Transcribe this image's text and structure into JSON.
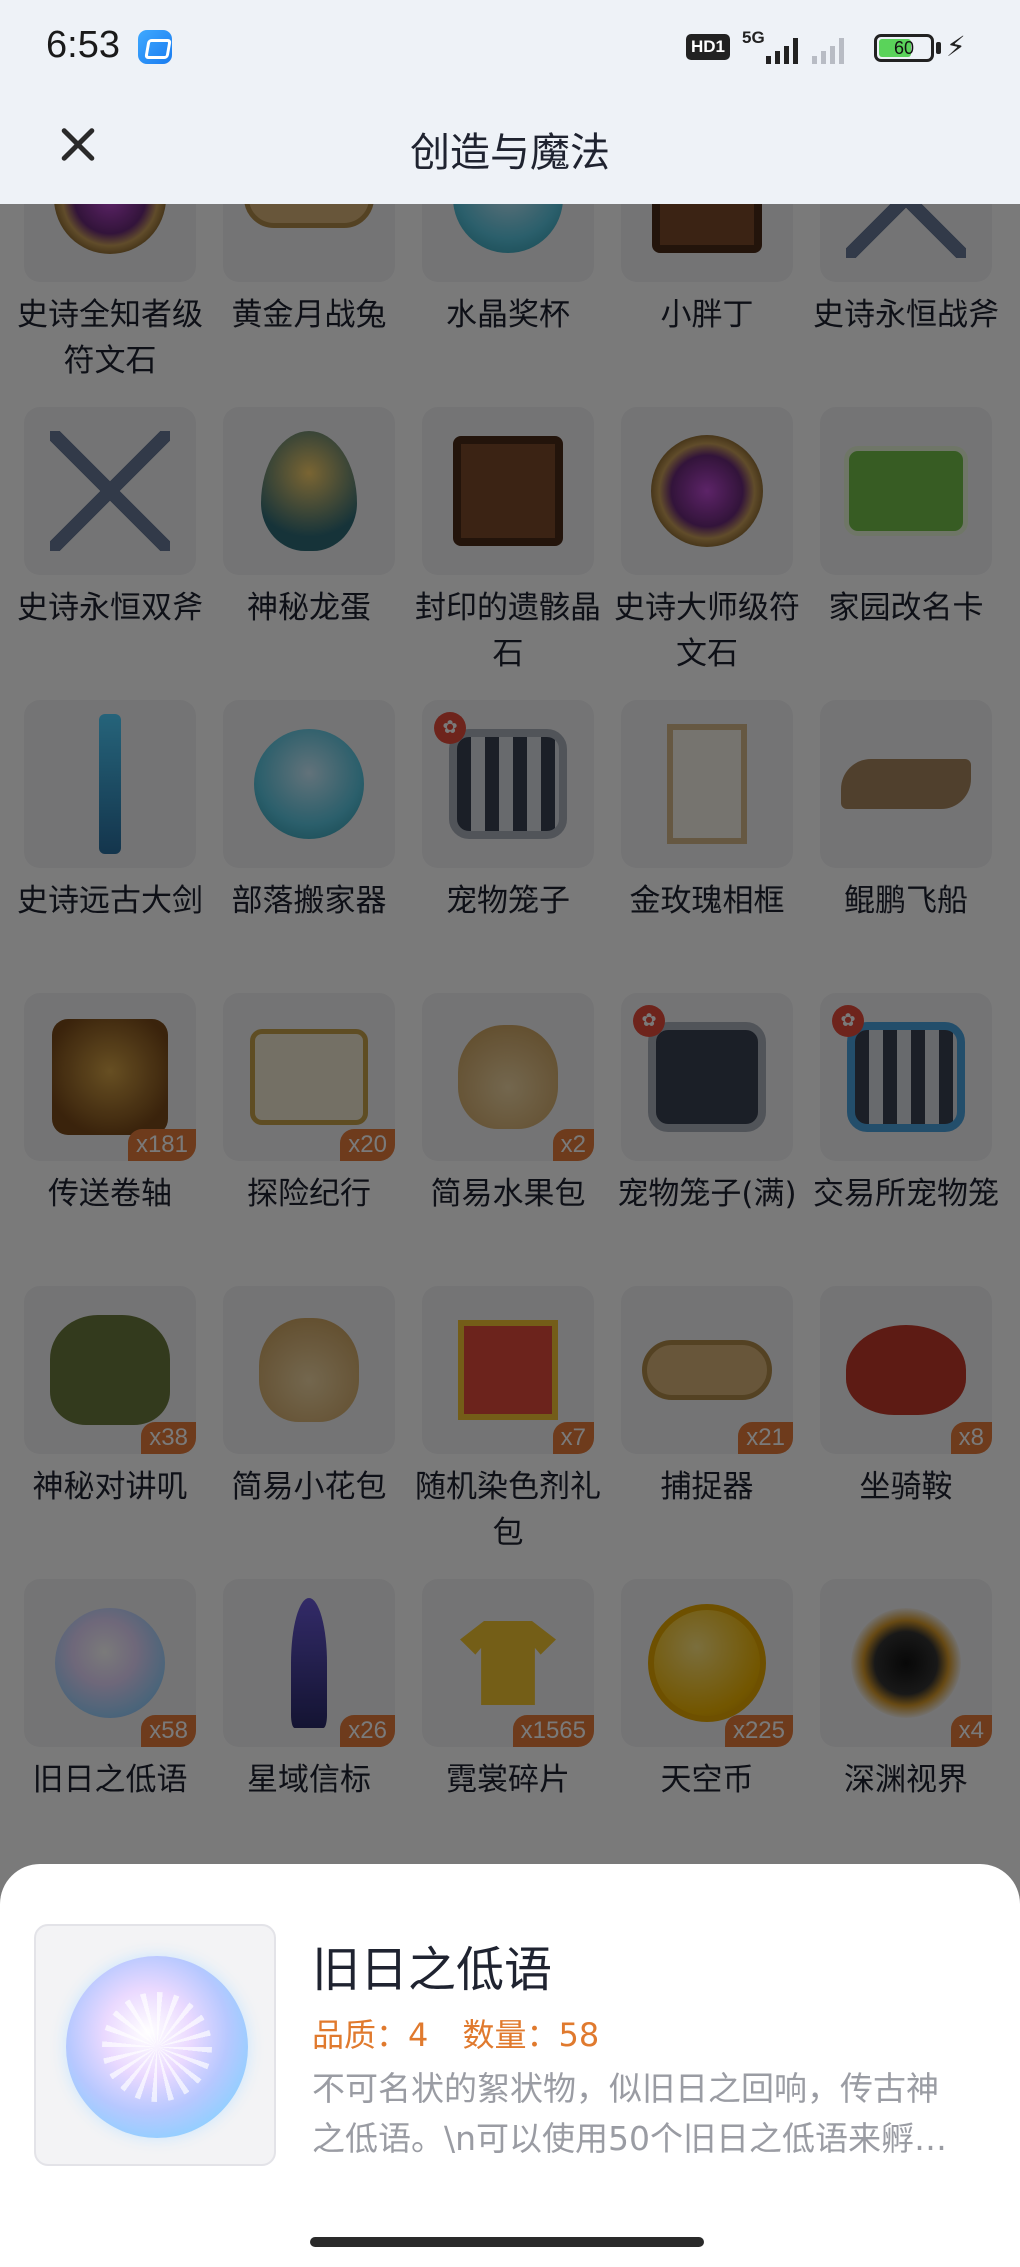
{
  "status_bar": {
    "time": "6:53",
    "hd_label": "HD1",
    "network_label": "5G",
    "battery": "60"
  },
  "header": {
    "title": "创造与魔法"
  },
  "items": [
    {
      "name": "史诗全知者级符文石",
      "art": "rune",
      "count": ""
    },
    {
      "name": "黄金月战兔",
      "art": "crown",
      "count": ""
    },
    {
      "name": "水晶奖杯",
      "art": "pot",
      "count": ""
    },
    {
      "name": "小胖丁",
      "art": "chest",
      "count": ""
    },
    {
      "name": "史诗永恒战斧",
      "art": "axes",
      "count": ""
    },
    {
      "name": "史诗永恒双斧",
      "art": "axes",
      "count": ""
    },
    {
      "name": "神秘龙蛋",
      "art": "egg",
      "count": ""
    },
    {
      "name": "封印的遗骸晶石",
      "art": "chest",
      "count": ""
    },
    {
      "name": "史诗大师级符文石",
      "art": "rune",
      "count": ""
    },
    {
      "name": "家园改名卡",
      "art": "card",
      "count": ""
    },
    {
      "name": "史诗远古大剑",
      "art": "sword",
      "count": ""
    },
    {
      "name": "部落搬家器",
      "art": "pot",
      "count": ""
    },
    {
      "name": "宠物笼子",
      "art": "cage",
      "count": "",
      "paw": true
    },
    {
      "name": "金玫瑰相框",
      "art": "frame",
      "count": ""
    },
    {
      "name": "鲲鹏飞船",
      "art": "ship",
      "count": ""
    },
    {
      "name": "传送卷轴",
      "art": "scroll2",
      "count": "x181"
    },
    {
      "name": "探险纪行",
      "art": "scroll",
      "count": "x20"
    },
    {
      "name": "简易水果包",
      "art": "bag",
      "count": "x2"
    },
    {
      "name": "宠物笼子(满)",
      "art": "cage full",
      "count": "",
      "paw": true
    },
    {
      "name": "交易所宠物笼",
      "art": "cage blue",
      "count": "",
      "paw": true
    },
    {
      "name": "神秘对讲叽",
      "art": "walkie",
      "count": "x38"
    },
    {
      "name": "简易小花包",
      "art": "bag",
      "count": ""
    },
    {
      "name": "随机染色剂礼包",
      "art": "giftbox",
      "count": "x7"
    },
    {
      "name": "捕捉器",
      "art": "crown",
      "count": "x21"
    },
    {
      "name": "坐骑鞍",
      "art": "saddle",
      "count": "x8"
    },
    {
      "name": "旧日之低语",
      "art": "orb",
      "count": "x58"
    },
    {
      "name": "星域信标",
      "art": "beacon",
      "count": "x26"
    },
    {
      "name": "霓裳碎片",
      "art": "shirt",
      "count": "x1565"
    },
    {
      "name": "天空币",
      "art": "coin",
      "count": "x225"
    },
    {
      "name": "深渊视界",
      "art": "vortex",
      "count": "x4"
    }
  ],
  "detail": {
    "name": "旧日之低语",
    "quality_label": "品质：4",
    "quantity_label": "数量：58",
    "description_line1": "不可名状的絮状物，似旧日之回响，传古神",
    "description_line2": "之低语。\\n可以使用50个旧日之低语来孵…"
  }
}
